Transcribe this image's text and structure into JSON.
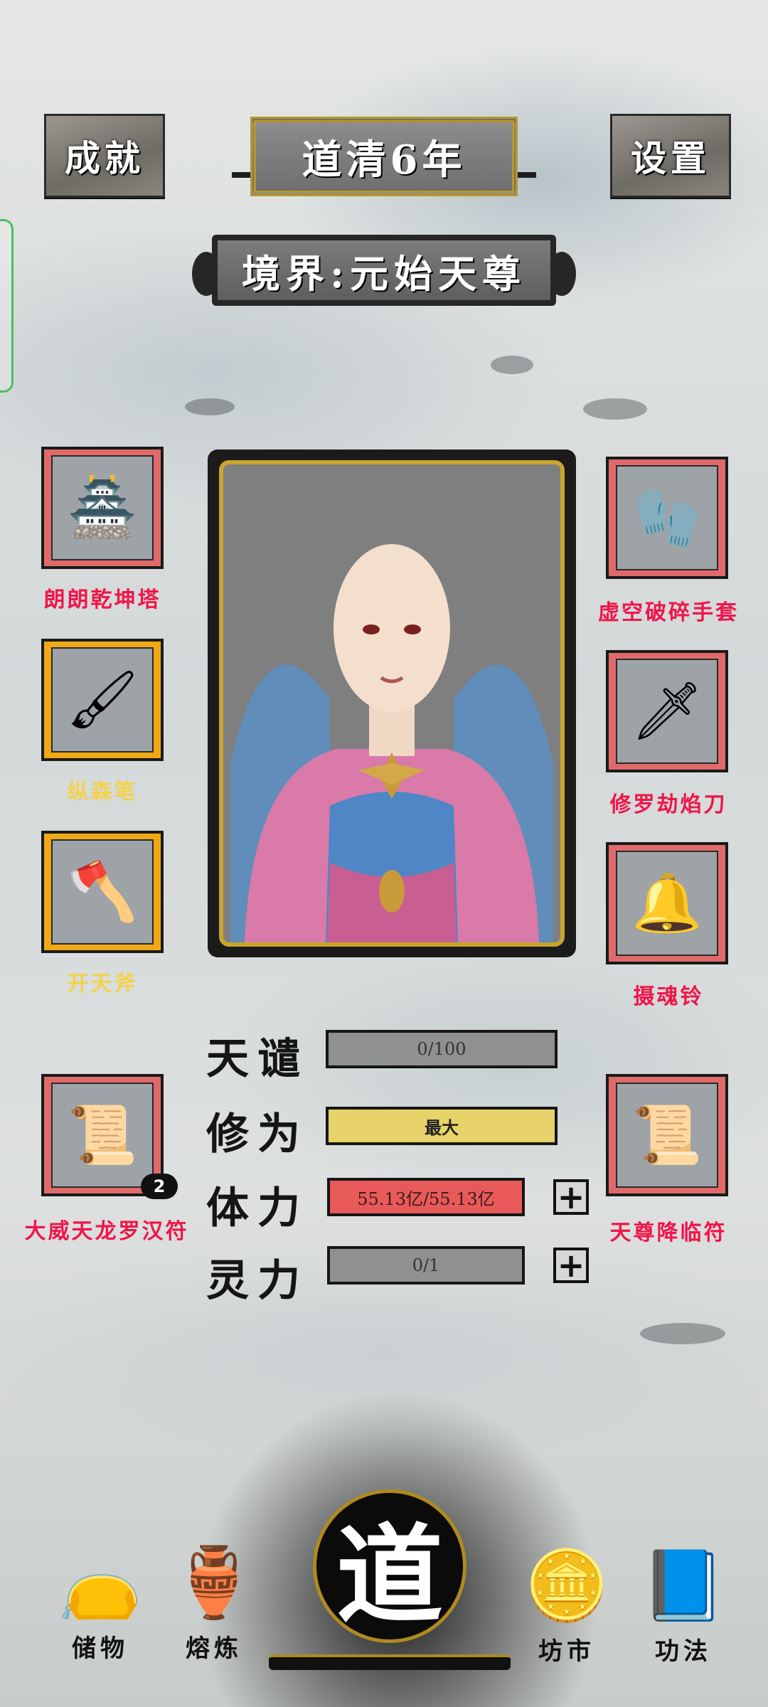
{
  "header": {
    "achievements_label": "成就",
    "year_label": "道清6年",
    "settings_label": "设置",
    "realm_label": "境界:元始天尊"
  },
  "equipment": {
    "left": [
      {
        "name": "朗朗乾坤塔",
        "rarity": "red",
        "icon": "pagoda-icon"
      },
      {
        "name": "纵森笔",
        "rarity": "gold",
        "icon": "brush-icon"
      },
      {
        "name": "开天斧",
        "rarity": "gold",
        "icon": "axe-icon"
      },
      {
        "name": "大威天龙罗汉符",
        "rarity": "red",
        "icon": "talisman-icon",
        "count": "2"
      }
    ],
    "right": [
      {
        "name": "虚空破碎手套",
        "rarity": "red",
        "icon": "gauntlet-icon"
      },
      {
        "name": "修罗劫焰刀",
        "rarity": "red",
        "icon": "flame-blade-icon"
      },
      {
        "name": "摄魂铃",
        "rarity": "red",
        "icon": "bell-icon"
      },
      {
        "name": "天尊降临符",
        "rarity": "red",
        "icon": "talisman-icon"
      }
    ]
  },
  "stats": {
    "tianqian": {
      "label": "天谴",
      "value": "0/100",
      "progress": 0
    },
    "xiuwei": {
      "label": "修为",
      "value": "最大",
      "progress": 1
    },
    "tili": {
      "label": "体力",
      "value": "55.13亿/55.13亿",
      "progress": 1
    },
    "lingli": {
      "label": "灵力",
      "value": "0/1",
      "progress": 0
    }
  },
  "nav": {
    "storage": "储物",
    "smelt": "熔炼",
    "dao": "道",
    "market": "坊市",
    "skills": "功法"
  },
  "colors": {
    "rarity_red": "#e06a6a",
    "rarity_gold": "#f0a816",
    "label_red": "#f0154a",
    "label_gold": "#f4d24a",
    "xiuwei_bar": "#e8d36a",
    "tili_bar": "#e85a5a",
    "empty_bar": "#8e9092",
    "frame_gold": "#c9a52e"
  }
}
